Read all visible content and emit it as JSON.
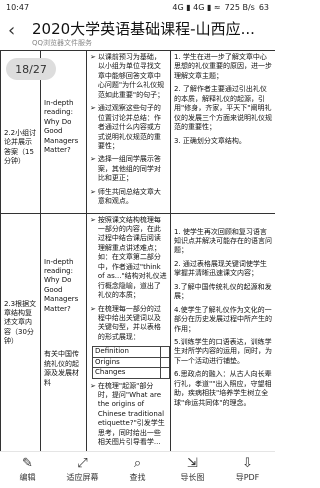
{
  "status": {
    "time": "10:47",
    "indicators": "4G ▮ 4G ▮ ≈",
    "speed": "725 B/s",
    "battery": "63"
  },
  "header": {
    "back_icon": "chevron-left-icon",
    "title": "2020大学英语基础课程-山西应...",
    "subtitle": "QQ浏览器文件服务"
  },
  "page_indicator": "18/27",
  "table": {
    "row1": {
      "col1": "2.2小组讨论并展示答案（15分钟）",
      "col2": "In-depth reading: Why Do Good Managers Matter?",
      "col3_bullets": [
        "以课前预习为基础，以小组为单位寻找文章中能够回答文章中心问题\"为什么礼仪规范如此重要\"的句子；",
        "通过观察这些句子的位置讨论并总结：作者通过什么内容或方式说明礼仪规范的重要性；",
        "选择一组同学展示答案，其他组的同学对比和更正；",
        "师生共同总结文章大意和观点。"
      ],
      "col4_items": [
        "1. 学生在进一步了解文章中心思想的礼仪重要的原因，进一步理解文章主题；",
        "2. 了解作者主要通过引出礼仪的本质，解释礼仪的起源，引用\"修身，齐家，平天下\"阐明礼仪的发展三个方面来说明礼仪规范的重要性；",
        "3. 正确划分文章结构。"
      ]
    },
    "row2": {
      "col1": "2.3根据文章结构复述文章内容（30分钟）",
      "col2_top": "In-depth reading: Why Do Good Managers Matter?",
      "col2_bottom": "有关中国传统礼仪的起源及发展材料",
      "col3_bullets": [
        "按照课文结构梳理每一部分的内容，在此过程中结合课后阅读理解重点讲述难点；如：在文章第二部分中，作者通过\"think of as...\"结构对礼仪进行概念隐喻，道出了礼仪的本质；",
        "在梳理每一部分的过程中给出关键词以及关键句型，并以表格的形式展现：",
        "在梳理\"起源\"部分时，提问\"What are the origins of Chinese traditional etiquette?\"引发学生思考，同时给出一些相关图片引导看学..."
      ],
      "inner_table": [
        "Definition",
        "Origins",
        "Changes"
      ],
      "col4_items": [
        "1. 使学生再次回顾和复习语言知识点并解决可能存在的语言问题；",
        "2. 通过表格展现关键词使学生掌握并清晰迅速课文内容；",
        "3.了解中国传统礼仪的起源和发展；",
        "4.使学生了解礼仪作为文化的一部分在历史发展过程中所产生的作用；",
        "5.训练学生的口语表达，训练学生对所学内容的运用，同时，为下一个活动进行铺垫。",
        "6.思政点的融入：从古人向长辈行礼，孝道\"\"出入照应，守望相助，疾病相扶\"培养学生树立全球\"命运共同体\"的理念。"
      ]
    }
  },
  "toolbar": [
    {
      "icon": "edit-icon",
      "label": "编辑"
    },
    {
      "icon": "fit-screen-icon",
      "label": "适应屏幕"
    },
    {
      "icon": "search-icon",
      "label": "查找"
    },
    {
      "icon": "export-image-icon",
      "label": "导长图"
    },
    {
      "icon": "pdf-icon",
      "label": "导PDF"
    }
  ]
}
